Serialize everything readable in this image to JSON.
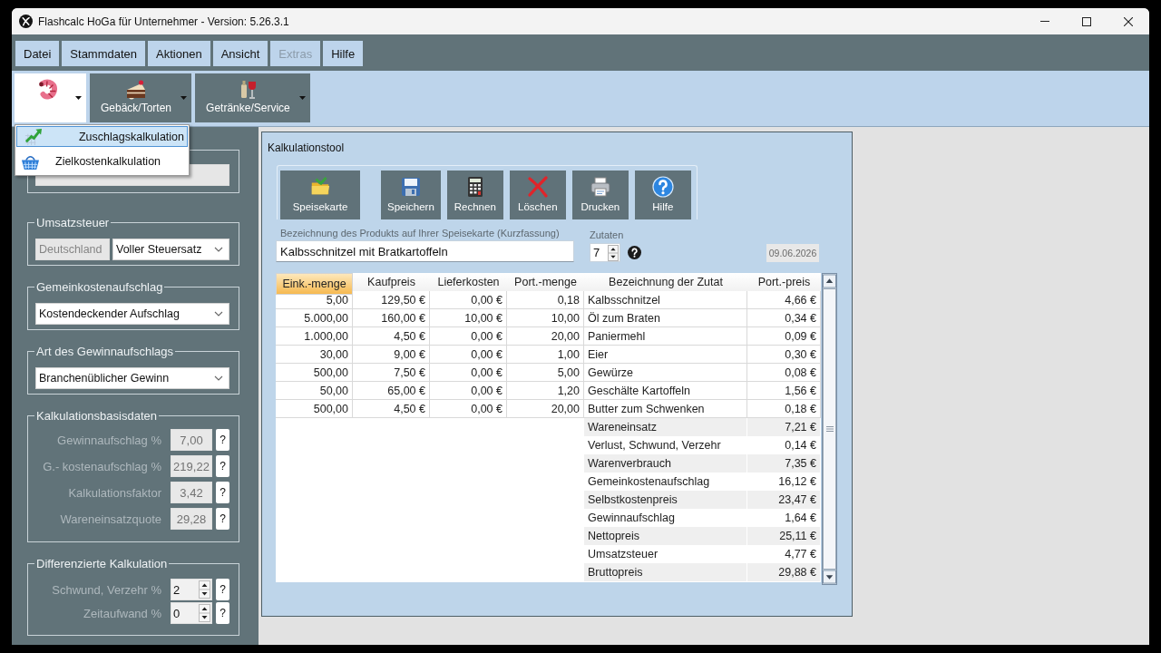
{
  "window": {
    "title": "Flashcalc HoGa für Unternehmer - Version: 5.26.3.1"
  },
  "menu": [
    {
      "label": "Datei",
      "disabled": false
    },
    {
      "label": "Stammdaten",
      "disabled": false
    },
    {
      "label": "Aktionen",
      "disabled": false
    },
    {
      "label": "Ansicht",
      "disabled": false
    },
    {
      "label": "Extras",
      "disabled": true
    },
    {
      "label": "Hilfe",
      "disabled": false
    }
  ],
  "category_buttons": [
    {
      "expanded": true
    },
    {
      "label": "Gebäck/Torten",
      "expanded": false
    },
    {
      "label": "Getränke/Service",
      "expanded": false
    }
  ],
  "category_menu": {
    "items": [
      {
        "label": "Zuschlagskalkulation",
        "selected": true
      },
      {
        "label": "Zielkostenkalkulation",
        "selected": false
      }
    ]
  },
  "settings_panel": {
    "groups": [
      {
        "controls": [
          {
            "kind": "field",
            "disabled": true
          }
        ]
      },
      {
        "legend": "Umsatzsteuer",
        "controls": [
          {
            "kind": "field",
            "value": "Deutschland",
            "disabled": true
          },
          {
            "kind": "select",
            "value": "Voller Steuersatz",
            "disabled": false
          }
        ]
      },
      {
        "legend": "Gemeinkostenaufschlag",
        "controls": [
          {
            "kind": "select",
            "value": "Kostendeckender Aufschlag",
            "disabled": false
          }
        ]
      },
      {
        "legend": "Art des Gewinnaufschlags",
        "controls": [
          {
            "kind": "select",
            "value": "Branchenüblicher Gewinn",
            "disabled": false
          }
        ]
      },
      {
        "legend": "Kalkulationsbasisdaten",
        "controls": [
          {
            "kind": "readout",
            "label": "Gewinnaufschlag %",
            "value": "7,00",
            "disabled": true,
            "help": "?"
          },
          {
            "kind": "readout",
            "label": "G.- kostenaufschlag %",
            "value": "219,22",
            "disabled": true,
            "help": "?"
          },
          {
            "kind": "readout",
            "label": "Kalkulationsfaktor",
            "value": "3,42",
            "disabled": true,
            "help": "?"
          },
          {
            "kind": "readout",
            "label": "Wareneinsatzquote",
            "value": "29,28",
            "disabled": true,
            "help": "?"
          }
        ]
      },
      {
        "legend": "Differenzierte Kalkulation",
        "controls": [
          {
            "kind": "spinner",
            "label": "Schwund, Verzehr %",
            "value": "2",
            "help": "?"
          },
          {
            "kind": "spinner",
            "label": "Zeitaufwand %",
            "value": "0",
            "help": "?"
          }
        ]
      }
    ]
  },
  "calculation_tool": {
    "title": "Kalkulationstool",
    "buttons": [
      {
        "label": "Speisekarte"
      },
      {
        "label": "Speichern"
      },
      {
        "label": "Rechnen"
      },
      {
        "label": "Löschen"
      },
      {
        "label": "Drucken"
      },
      {
        "label": "Hilfe"
      }
    ],
    "product_label": "Bezeichnung des Produkts auf Ihrer Speisekarte (Kurzfassung)",
    "product_name": "Kalbsschnitzel mit Bratkartoffeln",
    "ingredients_label": "Zutaten",
    "ingredients_count": "7",
    "date": "09.06.2026",
    "table": {
      "columns": [
        {
          "label": "Eink.-menge",
          "kind": "number",
          "selected": true
        },
        {
          "label": "Kaufpreis",
          "kind": "number",
          "selected": false
        },
        {
          "label": "Lieferkosten",
          "kind": "number",
          "selected": false
        },
        {
          "label": "Port.-menge",
          "kind": "number",
          "selected": false
        },
        {
          "label": "Bezeichnung der Zutat",
          "kind": "text",
          "selected": false
        },
        {
          "label": "Port.-preis",
          "kind": "number",
          "selected": false
        }
      ],
      "rows": [
        [
          "5,00",
          "129,50 €",
          "0,00 €",
          "0,18",
          "Kalbsschnitzel",
          "4,66 €"
        ],
        [
          "5.000,00",
          "160,00 €",
          "10,00 €",
          "10,00",
          "Öl zum Braten",
          "0,34 €"
        ],
        [
          "1.000,00",
          "4,50 €",
          "0,00 €",
          "20,00",
          "Paniermehl",
          "0,09 €"
        ],
        [
          "30,00",
          "9,00 €",
          "0,00 €",
          "1,00",
          "Eier",
          "0,30 €"
        ],
        [
          "500,00",
          "7,50 €",
          "0,00 €",
          "5,00",
          "Gewürze",
          "0,08 €"
        ],
        [
          "50,00",
          "65,00 €",
          "0,00 €",
          "1,20",
          "Geschälte Kartoffeln",
          "1,56 €"
        ],
        [
          "500,00",
          "4,50 €",
          "0,00 €",
          "20,00",
          "Butter zum Schwenken",
          "0,18 €"
        ]
      ],
      "summary": [
        {
          "label": "Wareneinsatz",
          "value": "7,21 €"
        },
        {
          "label": "Verlust, Schwund, Verzehr",
          "value": "0,14 €"
        },
        {
          "label": "Warenverbrauch",
          "value": "7,35 €"
        },
        {
          "label": "Gemeinkostenaufschlag",
          "value": "16,12 €"
        },
        {
          "label": "Selbstkostenpreis",
          "value": "23,47 €"
        },
        {
          "label": "Gewinnaufschlag",
          "value": "1,64 €"
        },
        {
          "label": "Nettopreis",
          "value": "25,11 €"
        },
        {
          "label": "Umsatzsteuer",
          "value": "4,77 €"
        },
        {
          "label": "Bruttopreis",
          "value": "29,88 €"
        }
      ]
    }
  }
}
